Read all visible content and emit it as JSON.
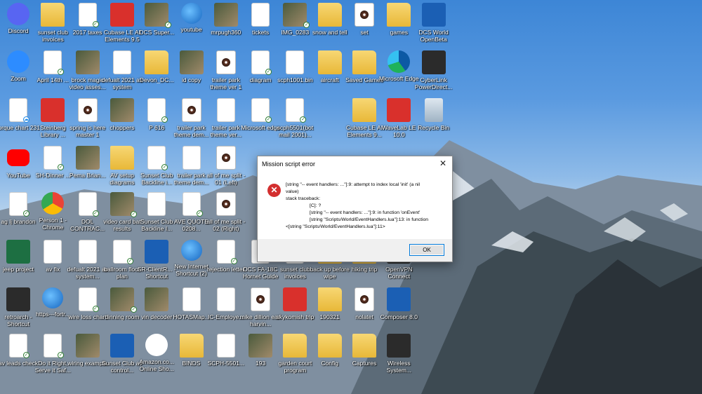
{
  "desktop": {
    "icons": [
      {
        "label": "Discord",
        "kind": "discord",
        "icon": "discord-icon",
        "badge": ""
      },
      {
        "label": "sunset club invoices",
        "kind": "folder",
        "icon": "folder-icon",
        "badge": ""
      },
      {
        "label": "2017 taxes",
        "kind": "doc",
        "icon": "spreadsheet-file-icon",
        "badge": "check"
      },
      {
        "label": "Cubase LE AI Elements 9.5",
        "kind": "red",
        "icon": "cubase-icon",
        "badge": ""
      },
      {
        "label": "DCS Super...",
        "kind": "img",
        "icon": "image-file-icon",
        "badge": "check"
      },
      {
        "label": "youtube",
        "kind": "web",
        "icon": "internet-shortcut-icon",
        "badge": ""
      },
      {
        "label": "mrpugh360",
        "kind": "img",
        "icon": "image-file-icon",
        "badge": ""
      },
      {
        "label": "tickets",
        "kind": "doc",
        "icon": "document-icon",
        "badge": ""
      },
      {
        "label": "IMG_0283",
        "kind": "img",
        "icon": "photo-icon",
        "badge": "check"
      },
      {
        "label": "snow and tell",
        "kind": "folder",
        "icon": "folder-icon",
        "badge": ""
      },
      {
        "label": "set",
        "kind": "disc",
        "icon": "media-file-icon",
        "badge": ""
      },
      {
        "label": "games",
        "kind": "folder",
        "icon": "folder-icon",
        "badge": ""
      },
      {
        "label": "DCS World OpenBeta",
        "kind": "blue",
        "icon": "dcs-icon",
        "badge": ""
      },
      {
        "label": "Zoom",
        "kind": "zoom",
        "icon": "zoom-icon",
        "badge": ""
      },
      {
        "label": "April 14th ...",
        "kind": "doc",
        "icon": "document-icon",
        "badge": "check"
      },
      {
        "label": "brock magic video asses...",
        "kind": "img",
        "icon": "video-file-icon",
        "badge": ""
      },
      {
        "label": "defualt 2021 av system",
        "kind": "doc",
        "icon": "document-icon",
        "badge": ""
      },
      {
        "label": "Devon_DC...",
        "kind": "folder",
        "icon": "folder-icon",
        "badge": ""
      },
      {
        "label": "id copy",
        "kind": "img",
        "icon": "image-file-icon",
        "badge": ""
      },
      {
        "label": "trailer park theme ver 1",
        "kind": "disc",
        "icon": "media-file-icon",
        "badge": ""
      },
      {
        "label": "diagram",
        "kind": "doc",
        "icon": "document-icon",
        "badge": "check"
      },
      {
        "label": "scph1001.bin",
        "kind": "doc",
        "icon": "file-icon",
        "badge": ""
      },
      {
        "label": "aircraft",
        "kind": "folder",
        "icon": "folder-icon",
        "badge": ""
      },
      {
        "label": "Saved Games",
        "kind": "folder",
        "icon": "folder-icon",
        "badge": ""
      },
      {
        "label": "Microsoft Edge",
        "kind": "edge",
        "icon": "edge-icon",
        "badge": ""
      },
      {
        "label": "CyberLink PowerDirect...",
        "kind": "app",
        "icon": "powerdirector-icon",
        "badge": ""
      },
      {
        "label": "torque chart 231",
        "kind": "doc",
        "icon": "document-icon",
        "badge": "cloud"
      },
      {
        "label": "Steinberg Library ...",
        "kind": "red",
        "icon": "steinberg-icon",
        "badge": ""
      },
      {
        "label": "spring is here master 1",
        "kind": "disc",
        "icon": "media-file-icon",
        "badge": ""
      },
      {
        "label": "choppers",
        "kind": "img",
        "icon": "image-file-icon",
        "badge": ""
      },
      {
        "label": "P 616",
        "kind": "doc",
        "icon": "document-icon",
        "badge": "check"
      },
      {
        "label": "trailer park theme dem...",
        "kind": "disc",
        "icon": "media-file-icon",
        "badge": ""
      },
      {
        "label": "trailer park theme ver...",
        "kind": "doc",
        "icon": "file-icon",
        "badge": ""
      },
      {
        "label": "Microsoft edge",
        "kind": "doc",
        "icon": "file-icon",
        "badge": "check"
      },
      {
        "label": "scph5501(bot mail 2001)...",
        "kind": "doc",
        "icon": "file-icon",
        "badge": "check"
      },
      {
        "label": "Cubase LE AI Elements 9...",
        "kind": "folder",
        "icon": "folder-icon",
        "badge": ""
      },
      {
        "label": "WaveLab LE 10.0",
        "kind": "red",
        "icon": "wavelab-icon",
        "badge": ""
      },
      {
        "label": "Recycle Bin",
        "kind": "recycle",
        "icon": "recycle-bin-icon",
        "badge": ""
      },
      {
        "label": "YouTube",
        "kind": "youtube",
        "icon": "youtube-icon",
        "badge": ""
      },
      {
        "label": "SH-Dinner ...",
        "kind": "doc",
        "icon": "document-icon",
        "badge": "check"
      },
      {
        "label": "Pema Brian...",
        "kind": "img",
        "icon": "image-file-icon",
        "badge": ""
      },
      {
        "label": "AV setup diagrams",
        "kind": "folder",
        "icon": "folder-icon",
        "badge": ""
      },
      {
        "label": "Sunset Club Backline i...",
        "kind": "doc",
        "icon": "document-icon",
        "badge": "check"
      },
      {
        "label": "trailer park theme dem...",
        "kind": "doc",
        "icon": "file-icon",
        "badge": ""
      },
      {
        "label": "all of me split - 01 (Left)",
        "kind": "disc",
        "icon": "media-file-icon",
        "badge": ""
      },
      {
        "label": "ag lj brandon",
        "kind": "doc",
        "icon": "document-icon",
        "badge": "check"
      },
      {
        "label": "Person 1 - Chrome",
        "kind": "chrome",
        "icon": "chrome-icon",
        "badge": ""
      },
      {
        "label": "DOL CONTRAC...",
        "kind": "doc",
        "icon": "document-icon",
        "badge": "check"
      },
      {
        "label": "video card bat results",
        "kind": "img",
        "icon": "image-file-icon",
        "badge": "check"
      },
      {
        "label": "Sunset Club Backline I...",
        "kind": "doc",
        "icon": "word-file-icon",
        "badge": ""
      },
      {
        "label": "AVE QUOTE 0208...",
        "kind": "doc",
        "icon": "document-icon",
        "badge": "check"
      },
      {
        "label": "all of me split - 02 (Right)",
        "kind": "disc",
        "icon": "media-file-icon",
        "badge": ""
      },
      {
        "label": "jeep project",
        "kind": "excel",
        "icon": "excel-icon",
        "badge": ""
      },
      {
        "label": "av fix",
        "kind": "doc",
        "icon": "document-icon",
        "badge": ""
      },
      {
        "label": "defualt 2021 av system...",
        "kind": "doc",
        "icon": "document-icon",
        "badge": ""
      },
      {
        "label": "ballroom floor plan",
        "kind": "doc",
        "icon": "document-icon",
        "badge": "check"
      },
      {
        "label": "SR-ClientR... - Shortcut",
        "kind": "blue",
        "icon": "shortcut-icon",
        "badge": ""
      },
      {
        "label": "New Internet Shortcut (2)",
        "kind": "web",
        "icon": "internet-shortcut-icon",
        "badge": ""
      },
      {
        "label": "rejection letter",
        "kind": "doc",
        "icon": "document-icon",
        "badge": "check"
      },
      {
        "label": "DCS FA-18C Hornet Guide",
        "kind": "doc",
        "icon": "pdf-icon",
        "badge": ""
      },
      {
        "label": "sunset club invoices",
        "kind": "doc",
        "icon": "document-icon",
        "badge": ""
      },
      {
        "label": "back up before wipe",
        "kind": "folder",
        "icon": "folder-icon",
        "badge": ""
      },
      {
        "label": "hiking trip",
        "kind": "folder",
        "icon": "folder-icon",
        "badge": ""
      },
      {
        "label": "OpenVPN Connect",
        "kind": "app",
        "icon": "openvpn-icon",
        "badge": ""
      },
      {
        "label": "retroarch - Shortcut",
        "kind": "app",
        "icon": "retroarch-icon",
        "badge": ""
      },
      {
        "label": "https---fortr...",
        "kind": "web",
        "icon": "internet-shortcut-icon",
        "badge": ""
      },
      {
        "label": "wire loss chart",
        "kind": "doc",
        "icon": "document-icon",
        "badge": "check"
      },
      {
        "label": "dinning room",
        "kind": "img",
        "icon": "image-file-icon",
        "badge": "check"
      },
      {
        "label": "vin decoder",
        "kind": "img",
        "icon": "image-file-icon",
        "badge": ""
      },
      {
        "label": "HOTASMap...",
        "kind": "doc",
        "icon": "file-icon",
        "badge": ""
      },
      {
        "label": "IC-Employe...",
        "kind": "doc",
        "icon": "word-file-icon",
        "badge": ""
      },
      {
        "label": "mike dillion earl harvin...",
        "kind": "disc",
        "icon": "media-file-icon",
        "badge": ""
      },
      {
        "label": "skykomish trip",
        "kind": "red",
        "icon": "zip-icon",
        "badge": ""
      },
      {
        "label": "190321",
        "kind": "folder",
        "icon": "folder-icon",
        "badge": ""
      },
      {
        "label": "nolatet",
        "kind": "disc",
        "icon": "media-file-icon",
        "badge": ""
      },
      {
        "label": "Composer 8.0",
        "kind": "blue",
        "icon": "composer-icon",
        "badge": ""
      },
      {
        "label": "av leads check",
        "kind": "doc",
        "icon": "document-icon",
        "badge": "check"
      },
      {
        "label": "Do it Right, Serve it Saf...",
        "kind": "doc",
        "icon": "pdf-icon",
        "badge": "check"
      },
      {
        "label": "wiring example",
        "kind": "img",
        "icon": "image-file-icon",
        "badge": ""
      },
      {
        "label": "Sunset Club av control...",
        "kind": "blue",
        "icon": "sv-icon",
        "badge": ""
      },
      {
        "label": "Amazon.co... Online Sho...",
        "kind": "amazon",
        "icon": "amazon-icon",
        "badge": ""
      },
      {
        "label": "BINDS",
        "kind": "folder",
        "icon": "folder-icon",
        "badge": ""
      },
      {
        "label": "SCPH-5501...",
        "kind": "doc",
        "icon": "file-icon",
        "badge": ""
      },
      {
        "label": "193",
        "kind": "img",
        "icon": "image-file-icon",
        "badge": ""
      },
      {
        "label": "garden court program",
        "kind": "folder",
        "icon": "folder-icon",
        "badge": ""
      },
      {
        "label": "Config",
        "kind": "folder",
        "icon": "folder-icon",
        "badge": ""
      },
      {
        "label": "Captures",
        "kind": "folder",
        "icon": "folder-icon",
        "badge": ""
      },
      {
        "label": "Wireless System...",
        "kind": "app",
        "icon": "wireless-system-icon",
        "badge": ""
      }
    ]
  },
  "dialog": {
    "title": "Mission script error",
    "close_glyph": "✕",
    "icon_glyph": "✕",
    "lines": [
      "[string \"-- event handlers: ...\"]:9: attempt to index local 'init' (a nil",
      "value)",
      "stack traceback:",
      "[C]: ?",
      "[string \"-- event handlers: ...\"]:9: in function 'onEvent'",
      "[string \"Scripts/World/EventHandlers.lua\"]:13: in function",
      "<[string \"Scripts/World/EventHandlers.lua\"]:11>"
    ],
    "ok_label": "OK"
  },
  "colors": {
    "sky": "#3d86d6",
    "error_red": "#d32f2f",
    "button_focus": "#0078d7"
  }
}
